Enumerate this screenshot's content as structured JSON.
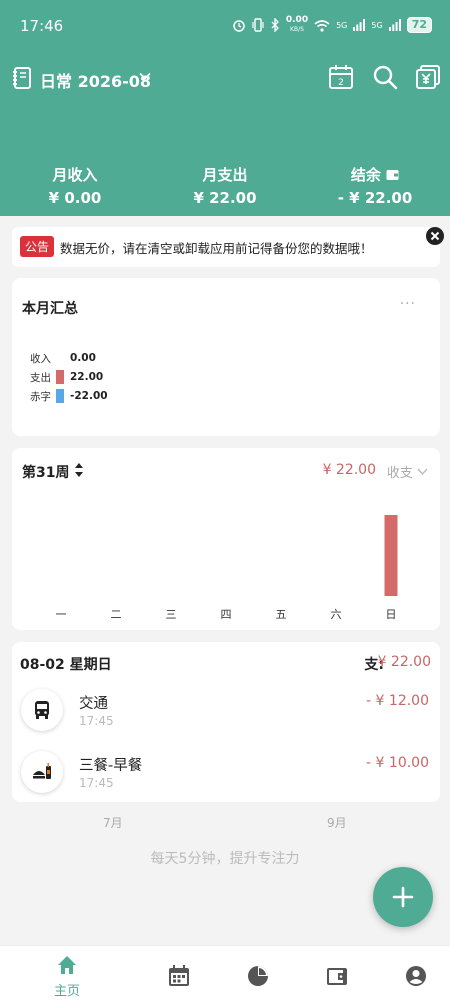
{
  "status": {
    "time": "17:46",
    "network": "0.00",
    "network_unit": "KB/S",
    "signal1": "5G",
    "signal2": "5G",
    "battery": "72"
  },
  "header": {
    "book_name": "日常",
    "month": "2026-08",
    "calendar_day": "2",
    "summary": [
      {
        "label": "月收入",
        "value": "¥ 0.00"
      },
      {
        "label": "月支出",
        "value": "¥ 22.00"
      },
      {
        "label": "结余",
        "value": "- ¥ 22.00"
      }
    ]
  },
  "notice": {
    "tag": "公告",
    "text": "数据无价，请在清空或卸载应用前记得备份您的数据哦！"
  },
  "month_summary": {
    "title": "本月汇总",
    "more": "···",
    "rows": [
      {
        "label": "收入",
        "value": "0.00",
        "color": "#ffffff"
      },
      {
        "label": "支出",
        "value": "22.00",
        "color": "#d46a6a"
      },
      {
        "label": "赤字",
        "value": "-22.00",
        "color": "#5aa7e8"
      }
    ]
  },
  "week": {
    "title": "第31周",
    "total": "¥ 22.00",
    "filter": "收支",
    "chart_data": {
      "type": "bar",
      "categories": [
        "一",
        "二",
        "三",
        "四",
        "五",
        "六",
        "日"
      ],
      "values": [
        0,
        0,
        0,
        0,
        0,
        0,
        22
      ],
      "color": "#d46a6a"
    }
  },
  "day": {
    "date": "08-02 星期日",
    "total_label": "支:",
    "total_value": "¥ 22.00",
    "transactions": [
      {
        "name": "交通",
        "time": "17:45",
        "amount": "- ¥ 12.00",
        "icon": "bus-icon"
      },
      {
        "name": "三餐-早餐",
        "time": "17:45",
        "amount": "- ¥ 10.00",
        "icon": "breakfast-icon"
      }
    ]
  },
  "month_nav": {
    "prev": "7月",
    "next": "9月"
  },
  "slogan": "每天5分钟，提升专注力",
  "nav": {
    "items": [
      {
        "label": "主页",
        "icon": "home-icon"
      }
    ]
  },
  "colors": {
    "primary": "#4fab93",
    "expense": "#c86666"
  }
}
